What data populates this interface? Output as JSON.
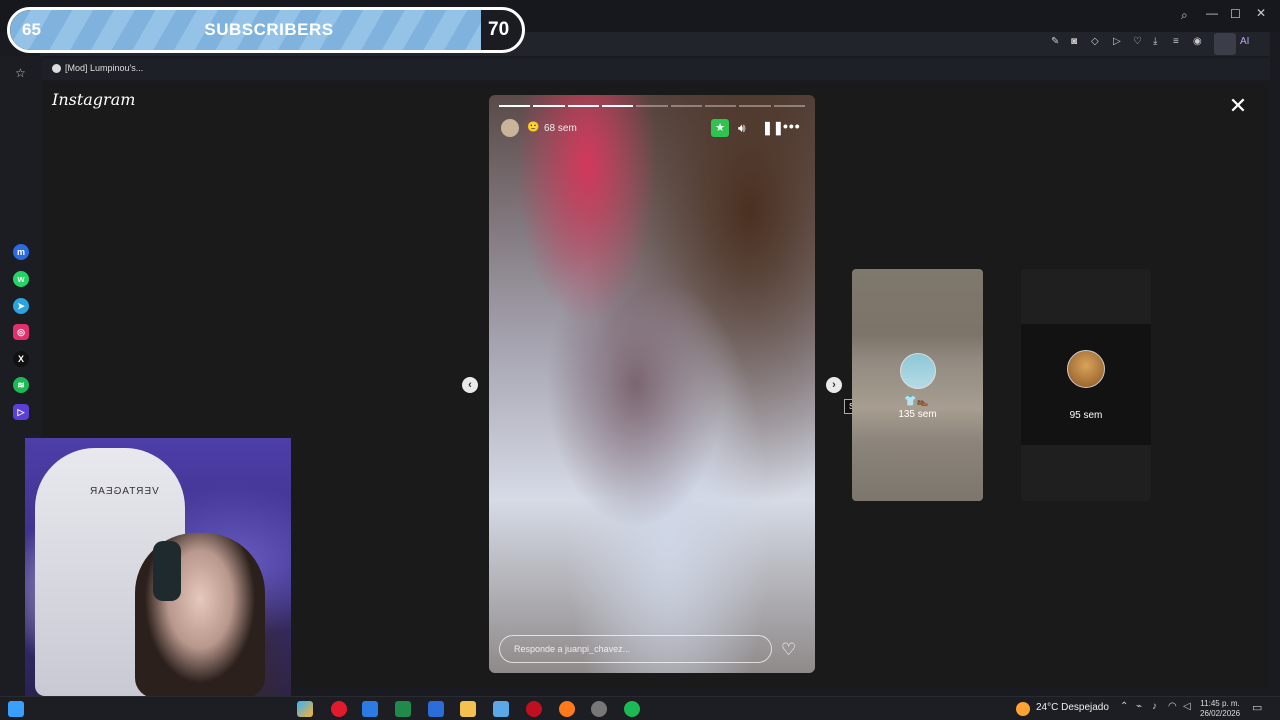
{
  "subscribers": {
    "current": "65",
    "label": "SUBSCRIBERS",
    "goal": "70",
    "progress_fraction": 0.93
  },
  "browser": {
    "bookmark_label": "[Mod] Lumpinou's..."
  },
  "instagram": {
    "logo": "Instagram",
    "story": {
      "age": "68 sem",
      "segments_total": 9,
      "segments_done": 4,
      "reply_placeholder": "Responde a juanpi_chavez..."
    },
    "next_tooltip": "Siguiente",
    "next_cards": [
      {
        "age": "135 sem"
      },
      {
        "age": "95 sem"
      }
    ]
  },
  "webcam": {
    "chair_text": "VERTAGEAR"
  },
  "taskbar": {
    "weather": "24°C  Despejado",
    "time": "11:45 p. m.",
    "date": "26/02/2026"
  },
  "colors": {
    "accent_green": "#2fc450",
    "subbar_fill": "#8cbde3"
  }
}
